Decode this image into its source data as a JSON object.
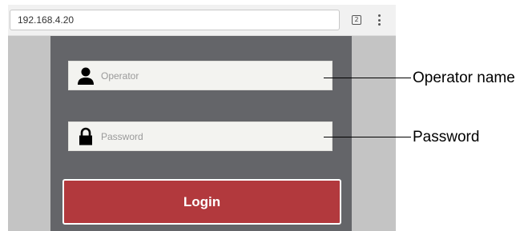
{
  "browser": {
    "url": "192.168.4.20",
    "tab_count": "2",
    "icons": [
      "tabs-icon",
      "menu-icon"
    ]
  },
  "login_form": {
    "operator": {
      "placeholder": "Operator",
      "icon": "person-icon"
    },
    "password": {
      "placeholder": "Password",
      "icon": "lock-icon"
    },
    "login_label": "Login"
  },
  "annotations": {
    "operator_name": "Operator name",
    "password": "Password"
  },
  "colors": {
    "panel": "#646569",
    "side_background": "#c4c4c4",
    "login_button": "#b2393d",
    "field_background": "#f3f3f0"
  }
}
